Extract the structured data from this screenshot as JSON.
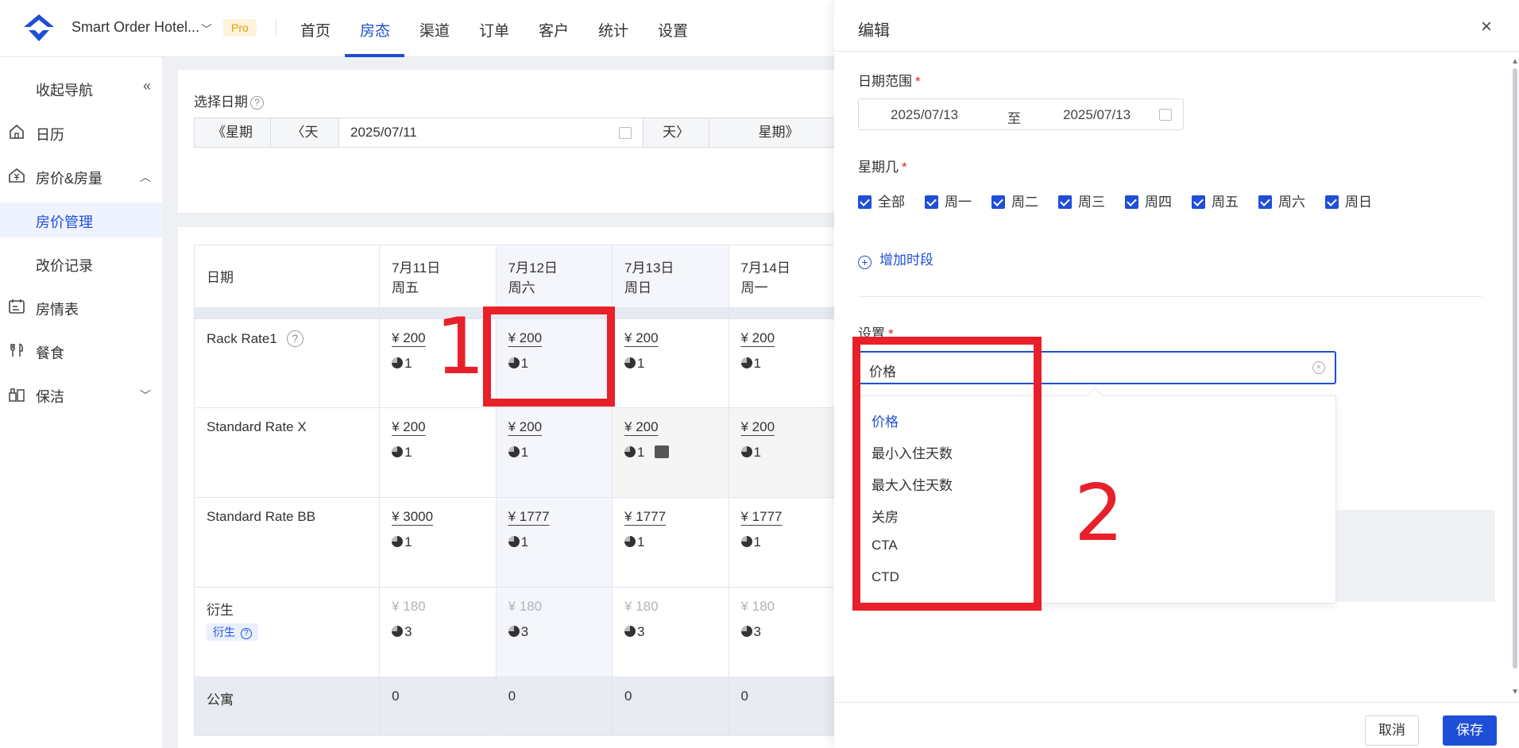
{
  "header": {
    "hotel_name": "Smart Order Hotel...",
    "badge": "Pro",
    "nav": [
      "首页",
      "房态",
      "渠道",
      "订单",
      "客户",
      "统计",
      "设置"
    ],
    "active_nav": "房态"
  },
  "sidebar": {
    "collapse_label": "收起导航",
    "items": [
      {
        "label": "日历",
        "icon": "home-icon"
      },
      {
        "label": "房价&房量",
        "icon": "yen-icon"
      },
      {
        "label": "房价管理"
      },
      {
        "label": "改价记录"
      },
      {
        "label": "房情表",
        "icon": "calendar-list-icon"
      },
      {
        "label": "餐食",
        "icon": "cutlery-icon"
      },
      {
        "label": "保洁",
        "icon": "cleaning-icon"
      }
    ]
  },
  "date_select": {
    "label": "选择日期",
    "prev_week": "《星期",
    "prev_day": "〈天",
    "date": "2025/07/11",
    "next_day": "天〉",
    "next_week": "星期》"
  },
  "table": {
    "corner": "日期",
    "columns": [
      {
        "date": "7月11日",
        "weekday": "周五"
      },
      {
        "date": "7月12日",
        "weekday": "周六"
      },
      {
        "date": "7月13日",
        "weekday": "周日"
      },
      {
        "date": "7月14日",
        "weekday": "周一"
      }
    ],
    "rows": [
      {
        "name": "Rack Rate1",
        "prices": [
          "¥ 200",
          "¥ 200",
          "¥ 200",
          "¥ 200"
        ],
        "counts": [
          "1",
          "1",
          "1",
          "1"
        ]
      },
      {
        "name": "Standard Rate X",
        "prices": [
          "¥ 200",
          "¥ 200",
          "¥ 200",
          "¥ 200"
        ],
        "counts": [
          "1",
          "1",
          "1",
          "1"
        ]
      },
      {
        "name": "Standard Rate BB",
        "prices": [
          "¥ 3000",
          "¥ 1777",
          "¥ 1777",
          "¥ 1777"
        ],
        "counts": [
          "1",
          "1",
          "1",
          "1"
        ]
      },
      {
        "name": "衍生",
        "tag": "衍生",
        "prices": [
          "¥ 180",
          "¥ 180",
          "¥ 180",
          "¥ 180"
        ],
        "counts": [
          "3",
          "3",
          "3",
          "3"
        ]
      },
      {
        "name": "公寓",
        "values": [
          "0",
          "0",
          "0",
          "0"
        ]
      }
    ]
  },
  "drawer": {
    "title": "编辑",
    "date_range_label": "日期范围",
    "start_date": "2025/07/13",
    "to": "至",
    "end_date": "2025/07/13",
    "weekday_label": "星期几",
    "weekdays": [
      "全部",
      "周一",
      "周二",
      "周三",
      "周四",
      "周五",
      "周六",
      "周日"
    ],
    "add_slot": "增加时段",
    "setting_label": "设置",
    "setting_value": "价格",
    "options": [
      "价格",
      "最小入住天数",
      "最大入住天数",
      "关房",
      "CTA",
      "CTD"
    ],
    "cancel": "取消",
    "save": "保存"
  },
  "annotations": [
    "1",
    "2"
  ],
  "colors": {
    "accent": "#1f4fd6",
    "annotation": "#e8202a"
  }
}
